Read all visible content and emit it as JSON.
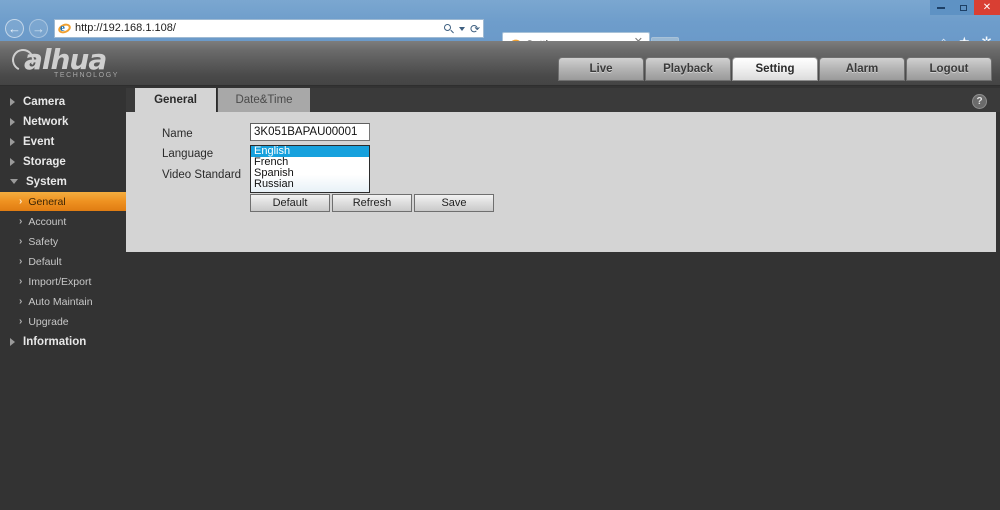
{
  "browser": {
    "url": "http://192.168.1.108/",
    "tab_title": "Setting",
    "tab_close_label": "✕",
    "back_label": "←",
    "forward_label": "→",
    "refresh_label": "⟳",
    "window_minimize_label": "–",
    "window_close_label": "✕",
    "home_icon_label": "⌂",
    "favorites_icon_label": "★",
    "tools_icon_label": "✲"
  },
  "app": {
    "brand_word": "alhua",
    "brand_sub": "TECHNOLOGY",
    "nav": [
      {
        "label": "Live",
        "active": false
      },
      {
        "label": "Playback",
        "active": false
      },
      {
        "label": "Setting",
        "active": true
      },
      {
        "label": "Alarm",
        "active": false
      },
      {
        "label": "Logout",
        "active": false
      }
    ]
  },
  "sidebar": {
    "items": [
      {
        "label": "Camera",
        "level": "top",
        "state": "collapsed"
      },
      {
        "label": "Network",
        "level": "top",
        "state": "collapsed"
      },
      {
        "label": "Event",
        "level": "top",
        "state": "collapsed"
      },
      {
        "label": "Storage",
        "level": "top",
        "state": "collapsed"
      },
      {
        "label": "System",
        "level": "top",
        "state": "expanded"
      },
      {
        "label": "General",
        "level": "sub",
        "state": "selected"
      },
      {
        "label": "Account",
        "level": "sub",
        "state": "normal"
      },
      {
        "label": "Safety",
        "level": "sub",
        "state": "normal"
      },
      {
        "label": "Default",
        "level": "sub",
        "state": "normal"
      },
      {
        "label": "Import/Export",
        "level": "sub",
        "state": "normal"
      },
      {
        "label": "Auto Maintain",
        "level": "sub",
        "state": "normal"
      },
      {
        "label": "Upgrade",
        "level": "sub",
        "state": "normal"
      },
      {
        "label": "Information",
        "level": "top",
        "state": "collapsed"
      }
    ]
  },
  "content": {
    "tabs": [
      {
        "label": "General",
        "active": true
      },
      {
        "label": "Date&Time",
        "active": false
      }
    ],
    "help_label": "?",
    "labels": {
      "name": "Name",
      "language": "Language",
      "video_standard": "Video Standard"
    },
    "name_value": "3K051BAPAU00001",
    "name_placeholder": "Name",
    "language_options": [
      {
        "label": "English",
        "selected": true
      },
      {
        "label": "French",
        "selected": false
      },
      {
        "label": "Spanish",
        "selected": false
      },
      {
        "label": "Russian",
        "selected": false
      }
    ],
    "language_selected": "English",
    "buttons": [
      {
        "label": "Default"
      },
      {
        "label": "Refresh"
      },
      {
        "label": "Save"
      }
    ]
  },
  "colors": {
    "accent_orange": "#ef9221",
    "selection_blue": "#17a1dd",
    "panel_gray": "#d4d4d4",
    "app_dark": "#333333",
    "chrome_blue": "#6e9dcb",
    "close_red": "#d93f33"
  }
}
